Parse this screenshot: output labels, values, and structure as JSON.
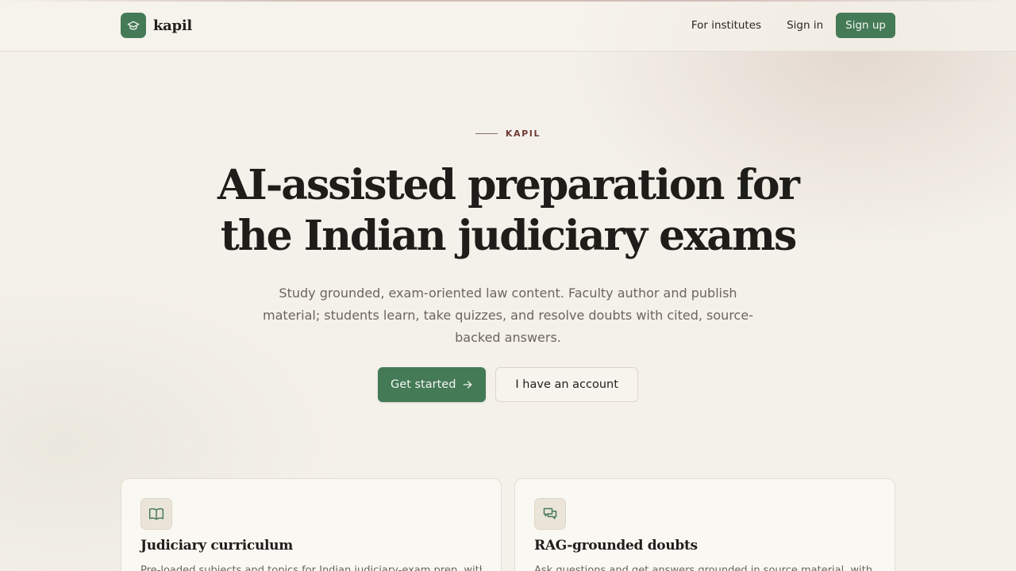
{
  "colors": {
    "brand_green": "#457a57",
    "background": "#f4f1ea",
    "accent_maroon": "#6e3b34",
    "text_dark": "#1f1d1a",
    "text_muted": "#6b665e"
  },
  "header": {
    "brand_icon": "graduation-cap-icon",
    "brand_name": "kapil",
    "nav": {
      "for_institutes": "For institutes",
      "sign_in": "Sign in",
      "sign_up": "Sign up"
    }
  },
  "hero": {
    "eyebrow": "KAPIL",
    "title_line1": "AI-assisted preparation for",
    "title_line2": "the Indian judiciary exams",
    "subtitle": "Study grounded, exam-oriented law content. Faculty author and publish material; students learn, take quizzes, and resolve doubts with cited, source-backed answers.",
    "primary_cta": "Get started",
    "primary_cta_icon": "arrow-right-icon",
    "secondary_cta": "I have an account"
  },
  "features": [
    {
      "icon": "open-book-icon",
      "title": "Judiciary curriculum",
      "text": "Pre-loaded subjects and topics for Indian judiciary-exam prep, with"
    },
    {
      "icon": "chat-bubbles-icon",
      "title": "RAG-grounded doubts",
      "text": "Ask questions and get answers grounded in source material, with"
    }
  ]
}
